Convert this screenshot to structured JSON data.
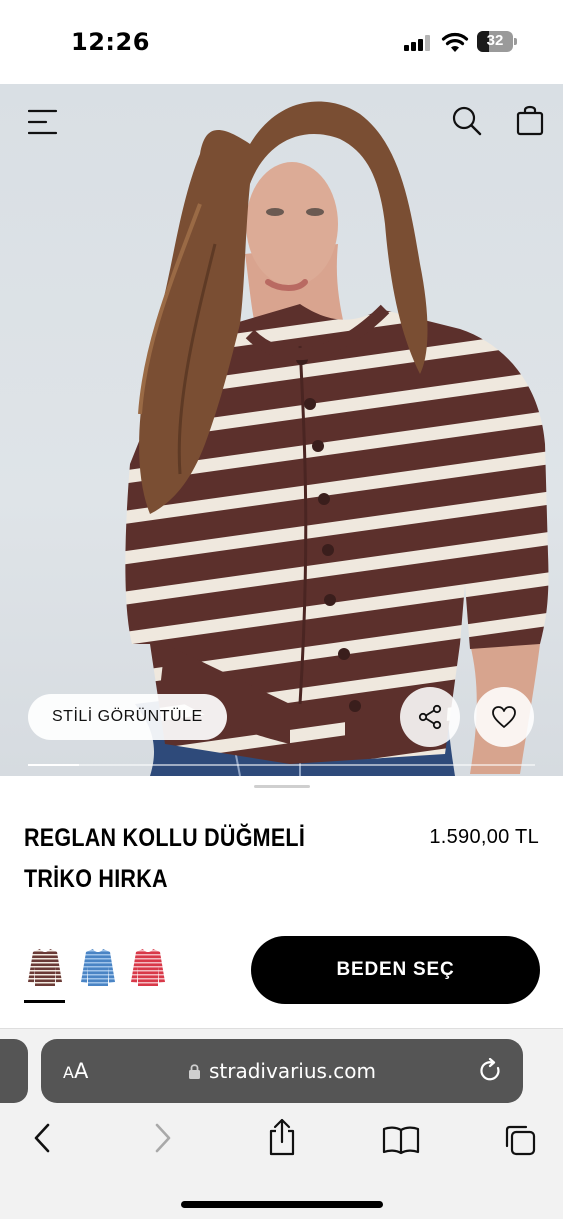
{
  "status_bar": {
    "time": "12:26",
    "battery_level": "32"
  },
  "header": {
    "menu_icon": "hamburger-menu-icon",
    "search_icon": "search-icon",
    "cart_icon": "shopping-bag-icon"
  },
  "hero": {
    "style_button_label": "STİLİ GÖRÜNTÜLE",
    "share_icon": "share-icon",
    "favorite_icon": "heart-icon",
    "gallery_progress": 0.1
  },
  "product": {
    "title": "REGLAN KOLLU DÜĞMELİ TRİKO HIRKA",
    "price": "1.590,00 TL",
    "color_swatches": [
      {
        "name": "brown-stripe",
        "color": "#6a3a36",
        "stripe": "#f1e9df",
        "selected": true
      },
      {
        "name": "blue-stripe",
        "color": "#4a84c4",
        "stripe": "#9fc3ea",
        "selected": false
      },
      {
        "name": "red-stripe",
        "color": "#d83848",
        "stripe": "#f3b9bf",
        "selected": false
      }
    ],
    "size_button_label": "BEDEN SEÇ"
  },
  "browser": {
    "text_size_small": "A",
    "text_size_big": "A",
    "domain": "stradivarius.com",
    "back_icon": "chevron-left-icon",
    "forward_icon": "chevron-right-icon",
    "share_icon": "share-square-icon",
    "bookmarks_icon": "book-icon",
    "tabs_icon": "tabs-icon"
  },
  "colors": {
    "accent": "#000000",
    "sweater": "#5c302c",
    "sweater_stripe": "#efe8de",
    "jeans": "#2e4a7a",
    "urlbar": "#555555"
  }
}
